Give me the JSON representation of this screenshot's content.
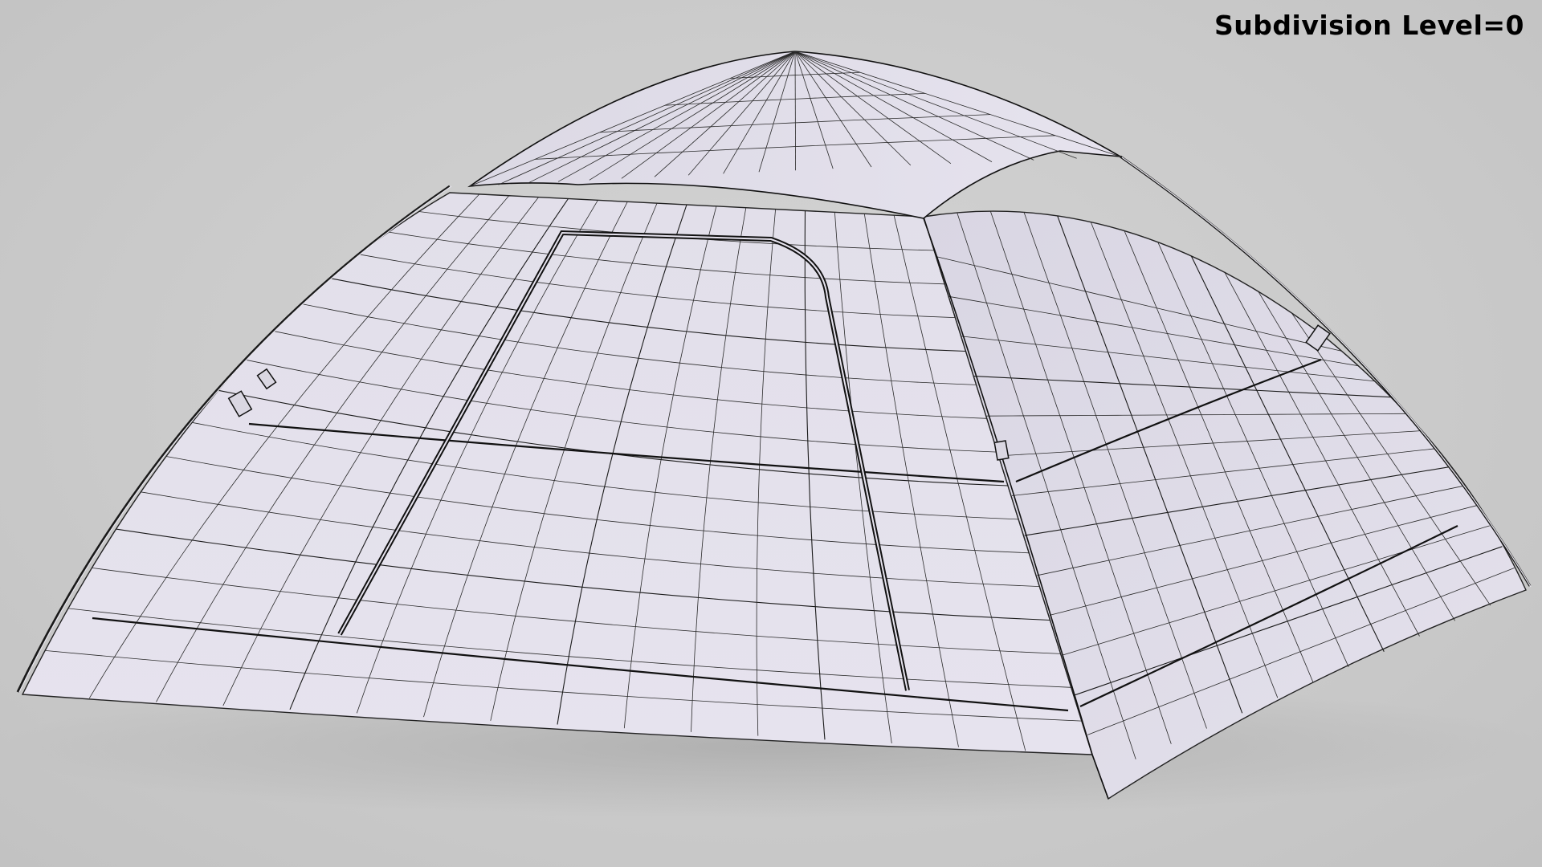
{
  "viewport": {
    "overlay_label": "Subdivision Level=0",
    "background_color": "#cbcbcb",
    "model_color": "#e3e0ea",
    "wire_color": "#1a1a1a"
  },
  "scene": {
    "object": "dome-tent-wireframe-render"
  }
}
